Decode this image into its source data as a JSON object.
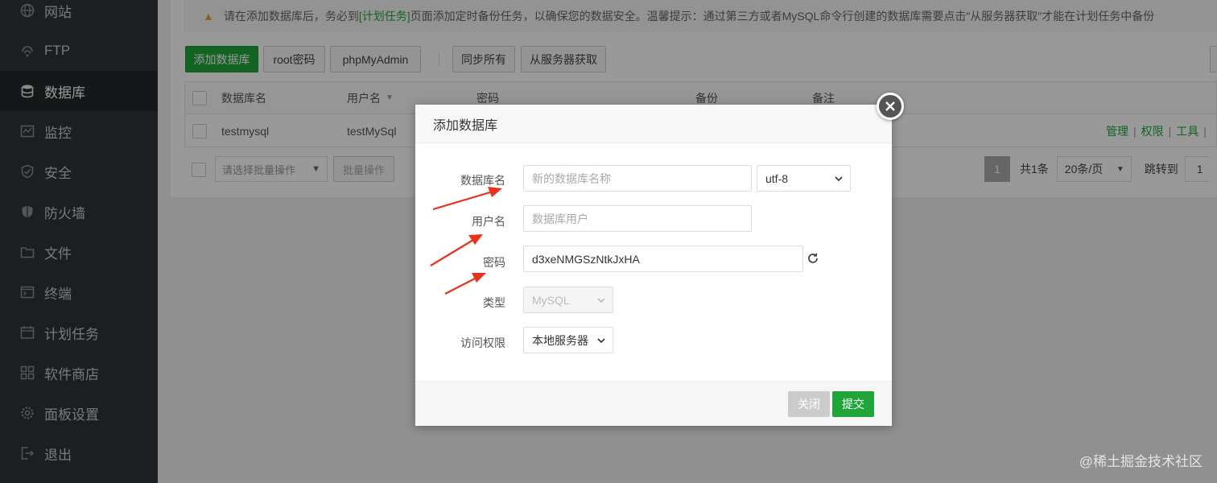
{
  "sidebar": {
    "items": [
      {
        "label": "网站",
        "icon": "globe-icon"
      },
      {
        "label": "FTP",
        "icon": "ftp-icon"
      },
      {
        "label": "数据库",
        "icon": "database-icon",
        "active": true
      },
      {
        "label": "监控",
        "icon": "monitor-icon"
      },
      {
        "label": "安全",
        "icon": "shield-icon"
      },
      {
        "label": "防火墙",
        "icon": "firewall-icon"
      },
      {
        "label": "文件",
        "icon": "folder-icon"
      },
      {
        "label": "终端",
        "icon": "terminal-icon"
      },
      {
        "label": "计划任务",
        "icon": "calendar-icon"
      },
      {
        "label": "软件商店",
        "icon": "grid-icon"
      },
      {
        "label": "面板设置",
        "icon": "gear-icon"
      },
      {
        "label": "退出",
        "icon": "logout-icon"
      }
    ]
  },
  "notice": {
    "prefix": "请在添加数据库后，务必到",
    "link": "[计划任务]",
    "suffix": "页面添加定时备份任务，以确保您的数据安全。温馨提示：通过第三方或者MySQL命令行创建的数据库需要点击\"从服务器获取\"才能在计划任务中备份"
  },
  "toolbar": {
    "add_db": "添加数据库",
    "root_pwd": "root密码",
    "phpmyadmin": "phpMyAdmin",
    "sync_all": "同步所有",
    "fetch_server": "从服务器获取"
  },
  "table": {
    "headers": [
      "数据库名",
      "用户名",
      "密码",
      "备份",
      "备注"
    ],
    "rows": [
      {
        "name": "testmysql",
        "user": "testMySql"
      }
    ],
    "ops": [
      "管理",
      "权限",
      "工具"
    ]
  },
  "batch": {
    "select_placeholder": "请选择批量操作",
    "batch_btn": "批量操作"
  },
  "pager": {
    "current": "1",
    "total": "共1条",
    "per_page": "20条/页",
    "jump_label": "跳转到",
    "jump_value": "1"
  },
  "modal": {
    "title": "添加数据库",
    "fields": {
      "db_name_label": "数据库名",
      "db_name_placeholder": "新的数据库名称",
      "charset": "utf-8",
      "user_label": "用户名",
      "user_placeholder": "数据库用户",
      "pwd_label": "密码",
      "pwd_value": "d3xeNMGSzNtkJxHA",
      "type_label": "类型",
      "type_value": "MySQL",
      "access_label": "访问权限",
      "access_value": "本地服务器"
    },
    "close_btn": "关闭",
    "submit_btn": "提交"
  },
  "watermark": "@稀土掘金技术社区",
  "colors": {
    "accent": "#20a53a",
    "sidebar": "#2f3438",
    "arrow": "#e8321e"
  }
}
